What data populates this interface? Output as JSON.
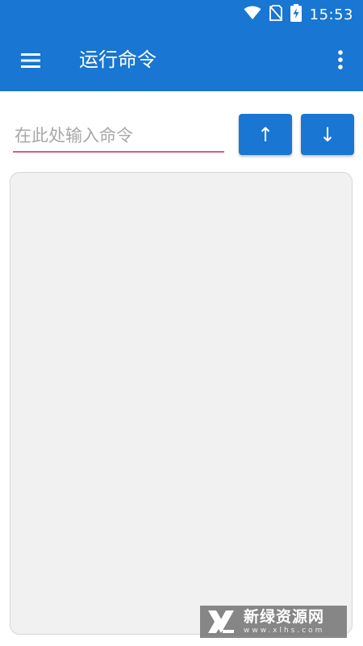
{
  "status_bar": {
    "time": "15:53",
    "icons": [
      "wifi-icon",
      "no-sim-icon",
      "battery-charging-icon"
    ]
  },
  "toolbar": {
    "menu_icon": "hamburger-menu-icon",
    "title": "运行命令",
    "overflow_icon": "more-vert-icon"
  },
  "command": {
    "value": "",
    "placeholder": "在此处输入命令",
    "history_up_label": "↑",
    "history_down_label": "↓"
  },
  "output": {
    "text": ""
  },
  "watermark": {
    "title": "新绿资源网",
    "url": "www.xlhs.com"
  },
  "colors": {
    "primary": "#1976d2",
    "accent": "#e05a86",
    "panel_background": "#f1f1f1"
  }
}
